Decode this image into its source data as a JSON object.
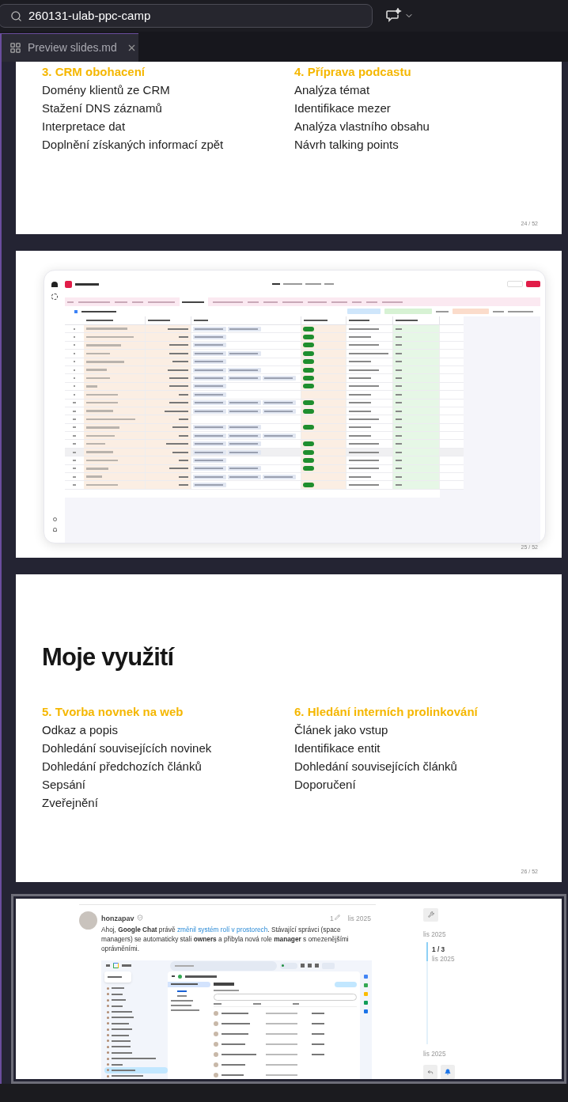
{
  "search": {
    "value": "260131-ulab-ppc-camp"
  },
  "tab": {
    "label": "Preview slides.md",
    "selected": true
  },
  "slides": [
    {
      "kind": "list",
      "selected": false,
      "page": "24 / 52",
      "columns": [
        {
          "heading": "3. CRM obohacení",
          "items": [
            "Domény klientů ze CRM",
            "Stažení DNS záznamů",
            "Interpretace dat",
            "Doplnění získaných informací zpět"
          ]
        },
        {
          "heading": "4. Příprava podcastu",
          "items": [
            "Analýza témat",
            "Identifikace mezer",
            "Analýza vlastního obsahu",
            "Návrh talking points"
          ]
        }
      ]
    },
    {
      "kind": "screenshot",
      "selected": false,
      "page": "25 / 52"
    },
    {
      "kind": "list",
      "selected": false,
      "page": "26 / 52",
      "title": "Moje využití",
      "columns": [
        {
          "heading": "5. Tvorba novnek na web",
          "items": [
            "Odkaz a popis",
            "Dohledání souvisejících novinek",
            "Dohledání předchozích článků",
            "Sepsání",
            "Zveřejnění"
          ]
        },
        {
          "heading": "6. Hledání interních prolinkování",
          "items": [
            "Článek jako vstup",
            "Identifikace entit",
            "Dohledání souvisejících článků",
            "Doporučení"
          ]
        }
      ]
    },
    {
      "kind": "post",
      "selected": true,
      "post": {
        "author": "honzapav",
        "edits": "1",
        "date": "lis 2025",
        "text_before": "Ahoj, **Google Chat** právě",
        "link": "změnil systém rolí v prostorech",
        "text_after": ". Stávající správci (space managers) se automaticky stali **owners** a přibyla nová role **manager** s omezenějšími oprávněními."
      },
      "sidebar": {
        "top_date": "lis 2025",
        "position": "1 / 3",
        "position_date": "lis 2025",
        "bottom_date": "lis 2025"
      }
    }
  ]
}
